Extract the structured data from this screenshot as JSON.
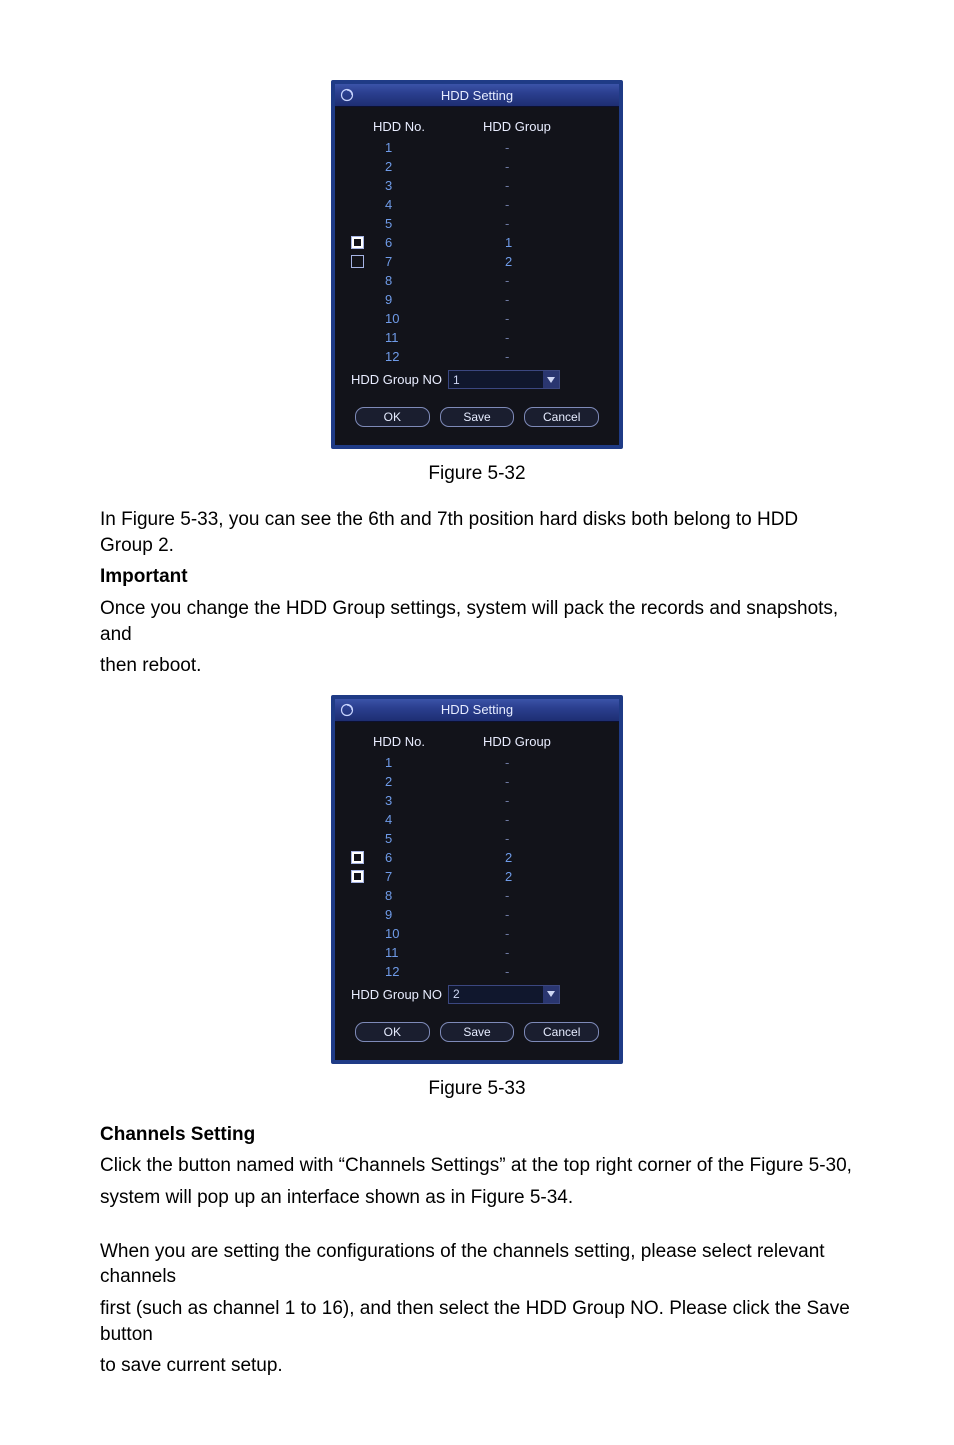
{
  "dialog1": {
    "title": "HDD Setting",
    "headers": {
      "no": "HDD No.",
      "group": "HDD Group"
    },
    "rows": [
      {
        "no": "1",
        "group": "-",
        "style": "dash",
        "check": "none"
      },
      {
        "no": "2",
        "group": "-",
        "style": "dash",
        "check": "none"
      },
      {
        "no": "3",
        "group": "-",
        "style": "dash",
        "check": "none"
      },
      {
        "no": "4",
        "group": "-",
        "style": "dash",
        "check": "none"
      },
      {
        "no": "5",
        "group": "-",
        "style": "dash",
        "check": "none"
      },
      {
        "no": "6",
        "group": "1",
        "style": "val",
        "check": "solid"
      },
      {
        "no": "7",
        "group": "2",
        "style": "val",
        "check": "outline"
      },
      {
        "no": "8",
        "group": "-",
        "style": "dash",
        "check": "none"
      },
      {
        "no": "9",
        "group": "-",
        "style": "dash",
        "check": "none"
      },
      {
        "no": "10",
        "group": "-",
        "style": "dash",
        "check": "none"
      },
      {
        "no": "11",
        "group": "-",
        "style": "dash",
        "check": "none"
      },
      {
        "no": "12",
        "group": "-",
        "style": "dash",
        "check": "none"
      }
    ],
    "groupNoLabel": "HDD Group NO",
    "groupNoValue": "1",
    "buttons": {
      "ok": "OK",
      "save": "Save",
      "cancel": "Cancel"
    }
  },
  "caption1": "Figure 5-32",
  "para1": "In Figure 5-33, you can see the 6th and 7th position hard disks both belong to HDD Group 2.",
  "important": "Important",
  "para2a": "Once you change the HDD Group settings, system will pack the records and snapshots, and",
  "para2b": "then reboot.",
  "dialog2": {
    "title": "HDD Setting",
    "headers": {
      "no": "HDD No.",
      "group": "HDD Group"
    },
    "rows": [
      {
        "no": "1",
        "group": "-",
        "style": "dash",
        "check": "none"
      },
      {
        "no": "2",
        "group": "-",
        "style": "dash",
        "check": "none"
      },
      {
        "no": "3",
        "group": "-",
        "style": "dash",
        "check": "none"
      },
      {
        "no": "4",
        "group": "-",
        "style": "dash",
        "check": "none"
      },
      {
        "no": "5",
        "group": "-",
        "style": "dash",
        "check": "none"
      },
      {
        "no": "6",
        "group": "2",
        "style": "val",
        "check": "solid"
      },
      {
        "no": "7",
        "group": "2",
        "style": "val",
        "check": "solid"
      },
      {
        "no": "8",
        "group": "-",
        "style": "dash",
        "check": "none"
      },
      {
        "no": "9",
        "group": "-",
        "style": "dash",
        "check": "none"
      },
      {
        "no": "10",
        "group": "-",
        "style": "dash",
        "check": "none"
      },
      {
        "no": "11",
        "group": "-",
        "style": "dash",
        "check": "none"
      },
      {
        "no": "12",
        "group": "-",
        "style": "dash",
        "check": "none"
      }
    ],
    "groupNoLabel": "HDD Group NO",
    "groupNoValue": "2",
    "buttons": {
      "ok": "OK",
      "save": "Save",
      "cancel": "Cancel"
    }
  },
  "caption2": "Figure 5-33",
  "channelsHeading": "Channels Setting",
  "para3a": "Click the button named with “Channels Settings” at the top right corner of the Figure 5-30,",
  "para3b": "system will pop up an interface shown as in Figure 5-34.",
  "para4a": "When you are setting the configurations of the channels setting, please select relevant channels",
  "para4b": "first (such as channel 1 to 16), and then select the HDD Group NO. Please click the Save button",
  "para4c": "to save current setup."
}
